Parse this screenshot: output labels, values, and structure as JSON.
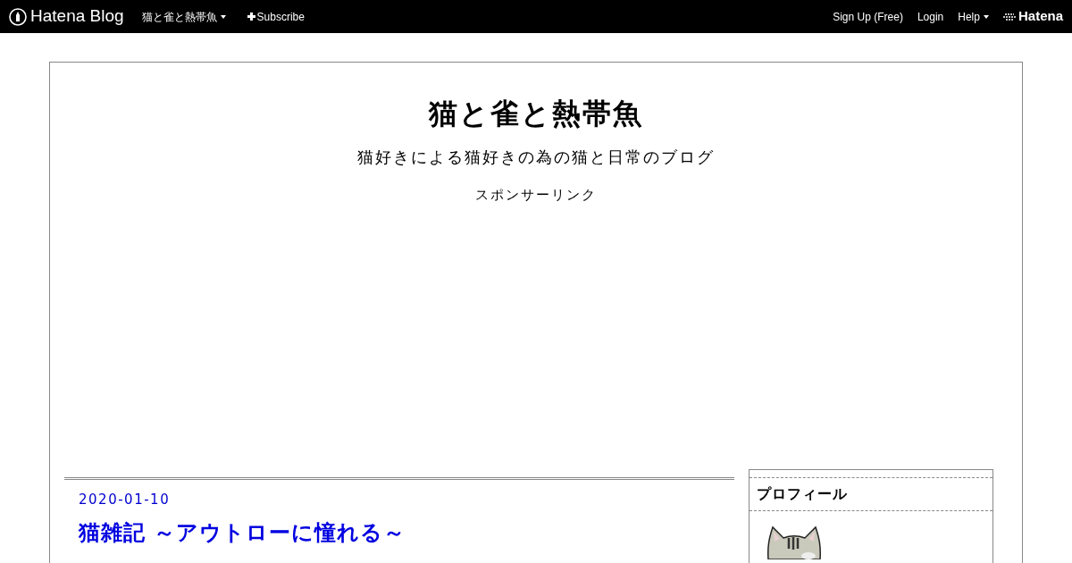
{
  "topbar": {
    "logo": "Hatena Blog",
    "blog_menu": "猫と雀と熱帯魚",
    "subscribe": "Subscribe",
    "links": [
      "Sign Up (Free)",
      "Login"
    ],
    "help": "Help",
    "brand": "Hatena"
  },
  "header": {
    "title": "猫と雀と熱帯魚",
    "description": "猫好きによる猫好きの為の猫と日常のブログ",
    "sponsored": "スポンサーリンク"
  },
  "entry": {
    "date": "2020-01-10",
    "title": "猫雑記 ～アウトローに憧れる～"
  },
  "sidebar": {
    "module_title": "プロフィール"
  }
}
